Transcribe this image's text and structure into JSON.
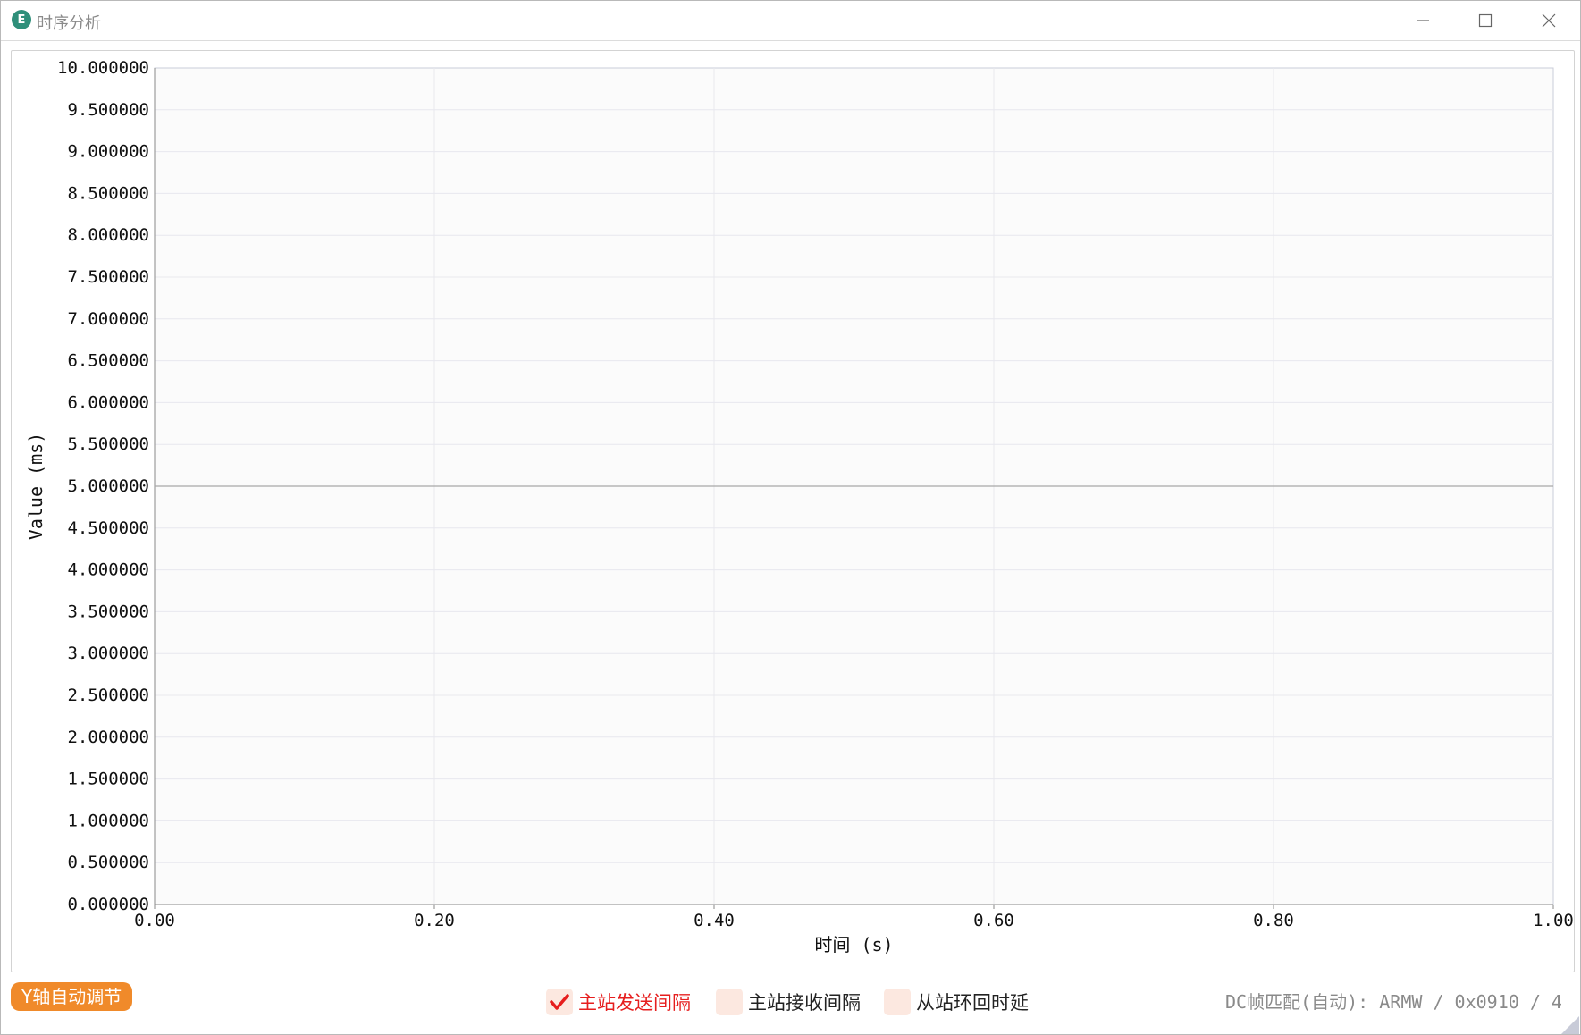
{
  "window": {
    "title": "时序分析",
    "app_icon": "E",
    "controls": [
      "minimize-icon",
      "maximize-icon",
      "close-icon"
    ]
  },
  "chart_data": {
    "type": "line",
    "ylabel": "Value (ms)",
    "xlabel": "时间 (s)",
    "ylim": [
      0,
      10
    ],
    "xlim": [
      0,
      1
    ],
    "y_ticks": [
      "10.000000",
      "9.500000",
      "9.000000",
      "8.500000",
      "8.000000",
      "7.500000",
      "7.000000",
      "6.500000",
      "6.000000",
      "5.500000",
      "5.000000",
      "4.500000",
      "4.000000",
      "3.500000",
      "3.000000",
      "2.500000",
      "2.000000",
      "1.500000",
      "1.000000",
      "0.500000",
      "0.000000"
    ],
    "x_ticks": [
      "0.00",
      "0.20",
      "0.40",
      "0.60",
      "0.80",
      "1.00"
    ],
    "grid": true,
    "reference_line": 5.0,
    "series": []
  },
  "bottom": {
    "y_auto_button": "Y轴自动调节",
    "series_toggles": [
      {
        "label": "主站发送间隔",
        "checked": true,
        "color": "#e61e1e"
      },
      {
        "label": "主站接收间隔",
        "checked": false,
        "color": "#222222"
      },
      {
        "label": "从站环回时延",
        "checked": false,
        "color": "#222222"
      }
    ],
    "dc_info": "DC帧匹配(自动): ARMW / 0x0910 / 4"
  }
}
